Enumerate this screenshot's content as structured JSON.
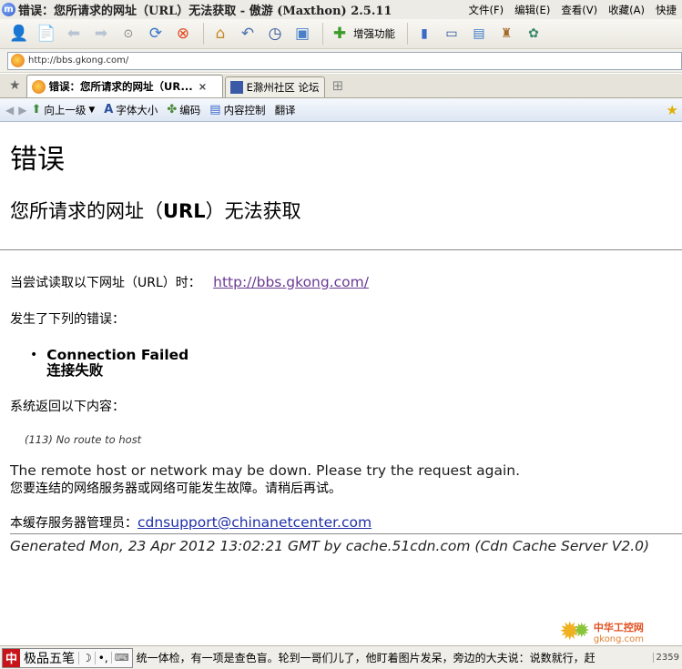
{
  "window": {
    "title": "错误：您所请求的网址（URL）无法获取 - 傲游 (Maxthon) 2.5.11",
    "menu": [
      "文件(F)",
      "编辑(E)",
      "查看(V)",
      "收藏(A)",
      "快捷"
    ]
  },
  "toolbar": {
    "enhance_label": "增强功能"
  },
  "address": {
    "url": "http://bbs.gkong.com/"
  },
  "tabs": [
    {
      "label": "错误：您所请求的网址（UR...",
      "active": true,
      "close": "×"
    },
    {
      "label": "E滁州社区 论坛",
      "active": false
    }
  ],
  "subbar": {
    "up_level": "向上一级",
    "font_size": "字体大小",
    "encoding": "编码",
    "content_control": "内容控制",
    "translate": "翻译"
  },
  "page": {
    "heading": "错误",
    "subheading_pre": "您所请求的网址（",
    "subheading_bold": "URL",
    "subheading_post": "）无法获取",
    "try_text": "当尝试读取以下网址（URL）时：",
    "try_link": "http://bbs.gkong.com/",
    "error_intro": "发生了下列的错误：",
    "error_en": "Connection Failed",
    "error_cn": "连接失败",
    "returned_intro": "系统返回以下内容：",
    "returned_code": "(113) No route to host",
    "remote_en": "The remote host or network may be down. Please try the request again.",
    "remote_cn": "您要连结的网络服务器或网络可能发生故障。请稍后再试。",
    "admin_label": "本缓存服务器管理员：",
    "admin_email": "cdnsupport@chinanetcenter.com",
    "generated": "Generated Mon, 23 Apr 2012 13:02:21 GMT by cache.51cdn.com (Cdn Cache Server V2.0)"
  },
  "statusbar": {
    "ime_logo": "中",
    "ime_name": "极品五笔",
    "ime_mode": "☽",
    "ime_punct": "•,",
    "ime_kbd": "⌨",
    "scroll_text": "统一体检，有一项是查色盲。轮到一哥们儿了，他盯着图片发呆，旁边的大夫说：说数就行，赶",
    "number": "2359"
  },
  "watermark": {
    "cn": "中华工控网",
    "en": "gkong.com"
  },
  "colors": {
    "link_visited": "#6b3a94",
    "link": "#2130a8"
  }
}
